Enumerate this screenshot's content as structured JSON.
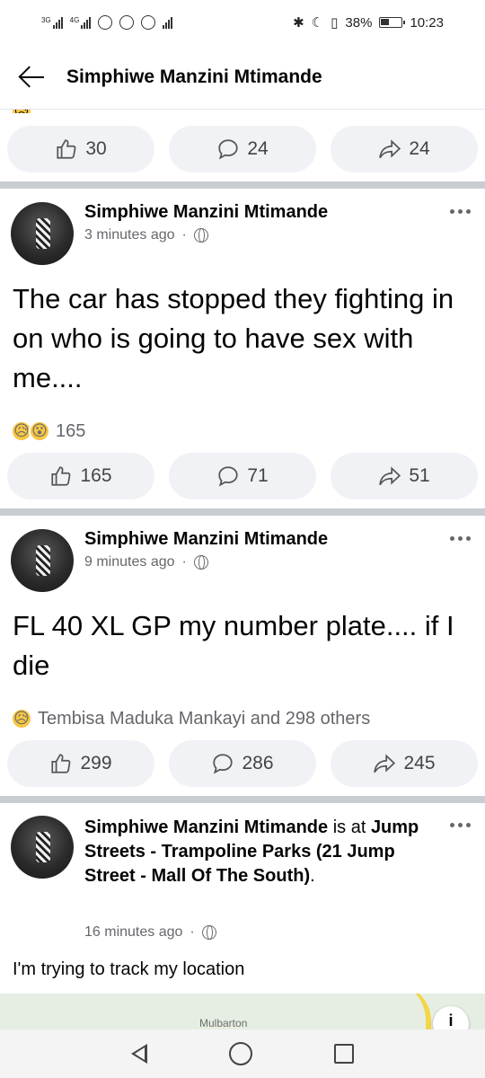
{
  "status_bar": {
    "network_1": "3G",
    "network_2": "4G",
    "battery": "38%",
    "time": "10:23"
  },
  "header": {
    "title": "Simphiwe Manzini Mtimande"
  },
  "top_actions": {
    "likes": "30",
    "comments": "24",
    "shares": "24"
  },
  "posts": [
    {
      "author": "Simphiwe Manzini Mtimande",
      "time": "3 minutes ago",
      "text": "The car has stopped they fighting in on who is going to have sex with me....",
      "reactions_label": "165",
      "likes": "165",
      "comments": "71",
      "shares": "51"
    },
    {
      "author": "Simphiwe Manzini Mtimande",
      "time": "9 minutes ago",
      "text": "FL 40 XL GP my number plate.... if I die",
      "reactions_label": "Tembisa Maduka Mankayi and 298 others",
      "likes": "299",
      "comments": "286",
      "shares": "245"
    },
    {
      "author": "Simphiwe Manzini Mtimande",
      "is_at": " is at ",
      "place": "Jump Streets - Trampoline Parks (21 Jump Street - Mall Of The South)",
      "period": ".",
      "time": "16 minutes ago",
      "text": "I'm trying to track my location",
      "map_label": "Mulbarton"
    }
  ],
  "icons": {
    "like": "thumbs-up-icon",
    "comment": "comment-bubble-icon",
    "share": "share-arrow-icon",
    "privacy": "globe-icon",
    "reaction_sad": "😥",
    "reaction_wow": "😮"
  }
}
